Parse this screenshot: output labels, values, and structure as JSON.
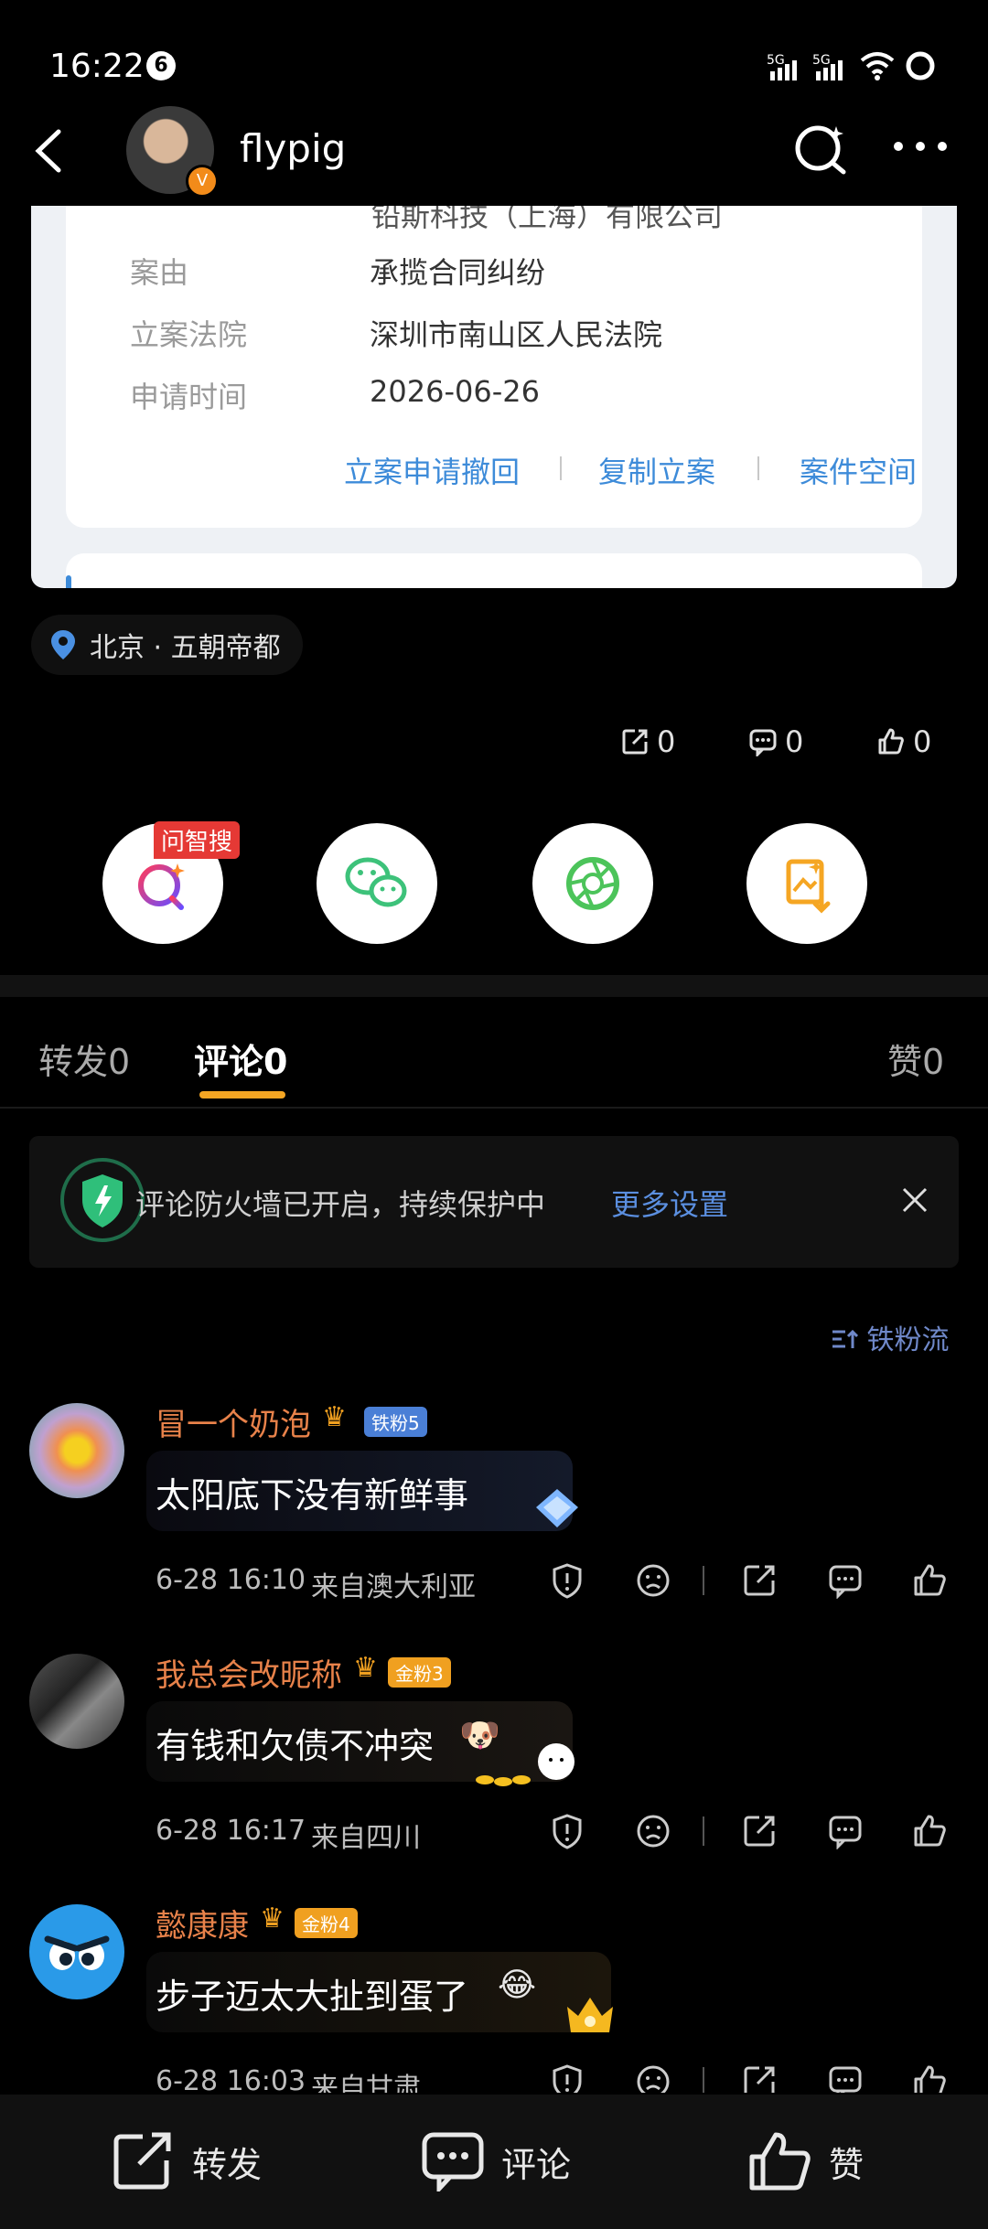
{
  "status_bar": {
    "time": "16:22",
    "notif_badge": "6"
  },
  "header": {
    "username": "flypig"
  },
  "case_card": {
    "clipped_text": "铅斯科技（上海）有限公司",
    "rows": [
      {
        "label": "案由",
        "value": "承揽合同纠纷"
      },
      {
        "label": "立案法院",
        "value": "深圳市南山区人民法院"
      },
      {
        "label": "申请时间",
        "value": "2026-06-26"
      }
    ],
    "actions": [
      "立案申请撤回",
      "复制立案",
      "案件空间"
    ]
  },
  "location": "北京 · 五朝帝都",
  "counts": {
    "repost": "0",
    "comment": "0",
    "like": "0"
  },
  "share": {
    "tag": "问智搜"
  },
  "tabs": {
    "repost": "转发",
    "repost_count": "0",
    "comment": "评论",
    "comment_count": "0",
    "like": "赞",
    "like_count": "0"
  },
  "notice": {
    "text": "评论防火墙已开启，持续保护中",
    "link": "更多设置"
  },
  "sort_label": "铁粉流",
  "comments": [
    {
      "name": "冒一个奶泡",
      "badge": "铁粉5",
      "text": "太阳底下没有新鲜事",
      "time": "6-28 16:10",
      "from": "来自澳大利亚",
      "badge_color": "#4a7fd6"
    },
    {
      "name": "我总会改昵称",
      "badge": "金粉3",
      "text": "有钱和欠债不冲突",
      "time": "6-28 16:17",
      "from": "来自四川",
      "badge_color": "#f0a020"
    },
    {
      "name": "懿康康",
      "badge": "金粉4",
      "text": "步子迈太大扯到蛋了",
      "time": "6-28 16:03",
      "from": "来自甘肃",
      "badge_color": "#f0a020"
    }
  ],
  "bottom_bar": {
    "repost": "转发",
    "comment": "评论",
    "like": "赞"
  }
}
